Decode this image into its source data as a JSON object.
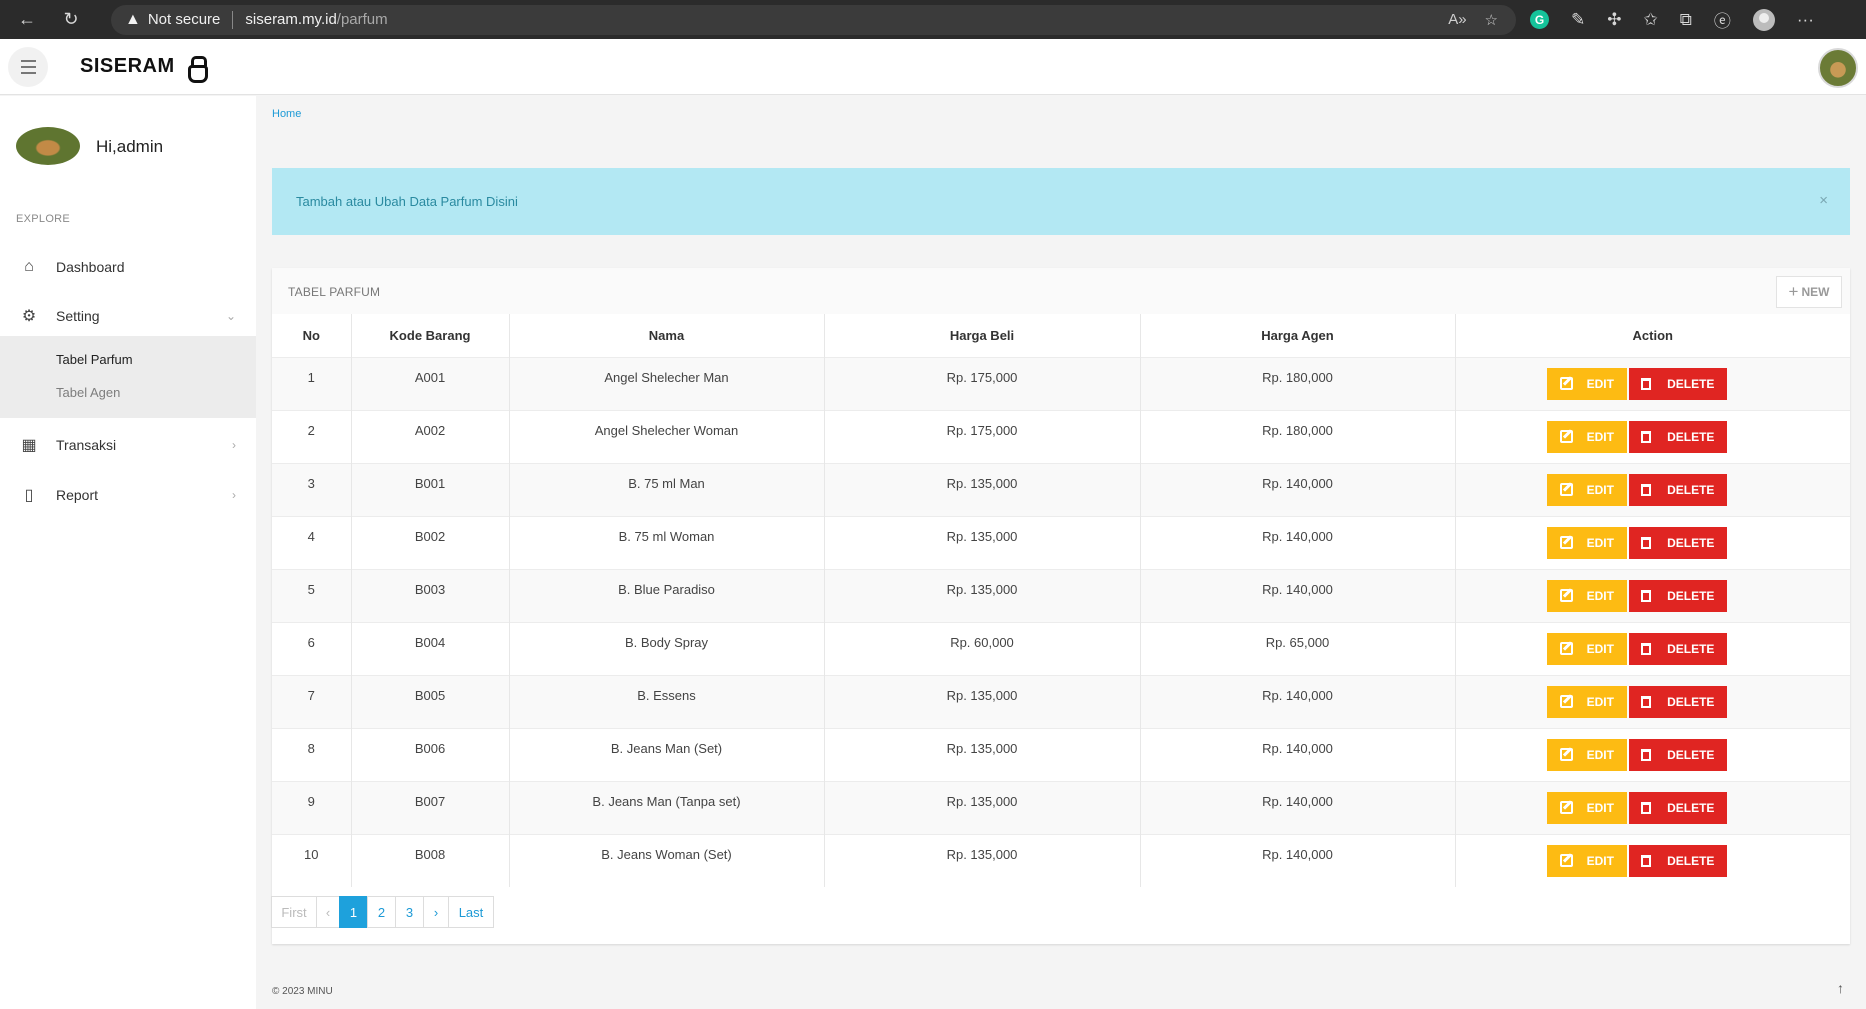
{
  "browser": {
    "not_secure": "Not secure",
    "url_host": "siseram.my.id",
    "url_path": "/parfum"
  },
  "app": {
    "brand": "SISERAM"
  },
  "sidebar": {
    "greeting": "Hi,admin",
    "section": "EXPLORE",
    "items": [
      {
        "label": "Dashboard",
        "icon": "home-icon"
      },
      {
        "label": "Setting",
        "icon": "gear-icon"
      },
      {
        "label": "Transaksi",
        "icon": "calendar-icon"
      },
      {
        "label": "Report",
        "icon": "file-icon"
      }
    ],
    "sub_items": [
      {
        "label": "Tabel Parfum",
        "active": true
      },
      {
        "label": "Tabel Agen",
        "active": false
      }
    ]
  },
  "breadcrumb": "Home",
  "alert": {
    "text": "Tambah atau Ubah Data Parfum Disini",
    "close": "×"
  },
  "panel": {
    "title": "TABEL PARFUM",
    "new_label": "NEW"
  },
  "table": {
    "headers": [
      "No",
      "Kode Barang",
      "Nama",
      "Harga Beli",
      "Harga Agen",
      "Action"
    ],
    "edit_label": "EDIT",
    "delete_label": "DELETE",
    "rows": [
      {
        "no": "1",
        "kode": "A001",
        "nama": "Angel Shelecher Man",
        "beli": "Rp. 175,000",
        "agen": "Rp. 180,000"
      },
      {
        "no": "2",
        "kode": "A002",
        "nama": "Angel Shelecher Woman",
        "beli": "Rp. 175,000",
        "agen": "Rp. 180,000"
      },
      {
        "no": "3",
        "kode": "B001",
        "nama": "B. 75 ml Man",
        "beli": "Rp. 135,000",
        "agen": "Rp. 140,000"
      },
      {
        "no": "4",
        "kode": "B002",
        "nama": "B. 75 ml Woman",
        "beli": "Rp. 135,000",
        "agen": "Rp. 140,000"
      },
      {
        "no": "5",
        "kode": "B003",
        "nama": "B. Blue Paradiso",
        "beli": "Rp. 135,000",
        "agen": "Rp. 140,000"
      },
      {
        "no": "6",
        "kode": "B004",
        "nama": "B. Body Spray",
        "beli": "Rp. 60,000",
        "agen": "Rp. 65,000"
      },
      {
        "no": "7",
        "kode": "B005",
        "nama": "B. Essens",
        "beli": "Rp. 135,000",
        "agen": "Rp. 140,000"
      },
      {
        "no": "8",
        "kode": "B006",
        "nama": "B. Jeans Man (Set)",
        "beli": "Rp. 135,000",
        "agen": "Rp. 140,000"
      },
      {
        "no": "9",
        "kode": "B007",
        "nama": "B. Jeans Man (Tanpa set)",
        "beli": "Rp. 135,000",
        "agen": "Rp. 140,000"
      },
      {
        "no": "10",
        "kode": "B008",
        "nama": "B. Jeans Woman (Set)",
        "beli": "Rp. 135,000",
        "agen": "Rp. 140,000"
      }
    ]
  },
  "pagination": {
    "first": "First",
    "prev": "‹",
    "pages": [
      "1",
      "2",
      "3"
    ],
    "current": "1",
    "next": "›",
    "last": "Last"
  },
  "footer": "© 2023 MINU",
  "colors": {
    "edit": "#fdbb13",
    "delete": "#e02522",
    "accent": "#1ea1dc",
    "alert_bg": "#b3e8f3"
  }
}
